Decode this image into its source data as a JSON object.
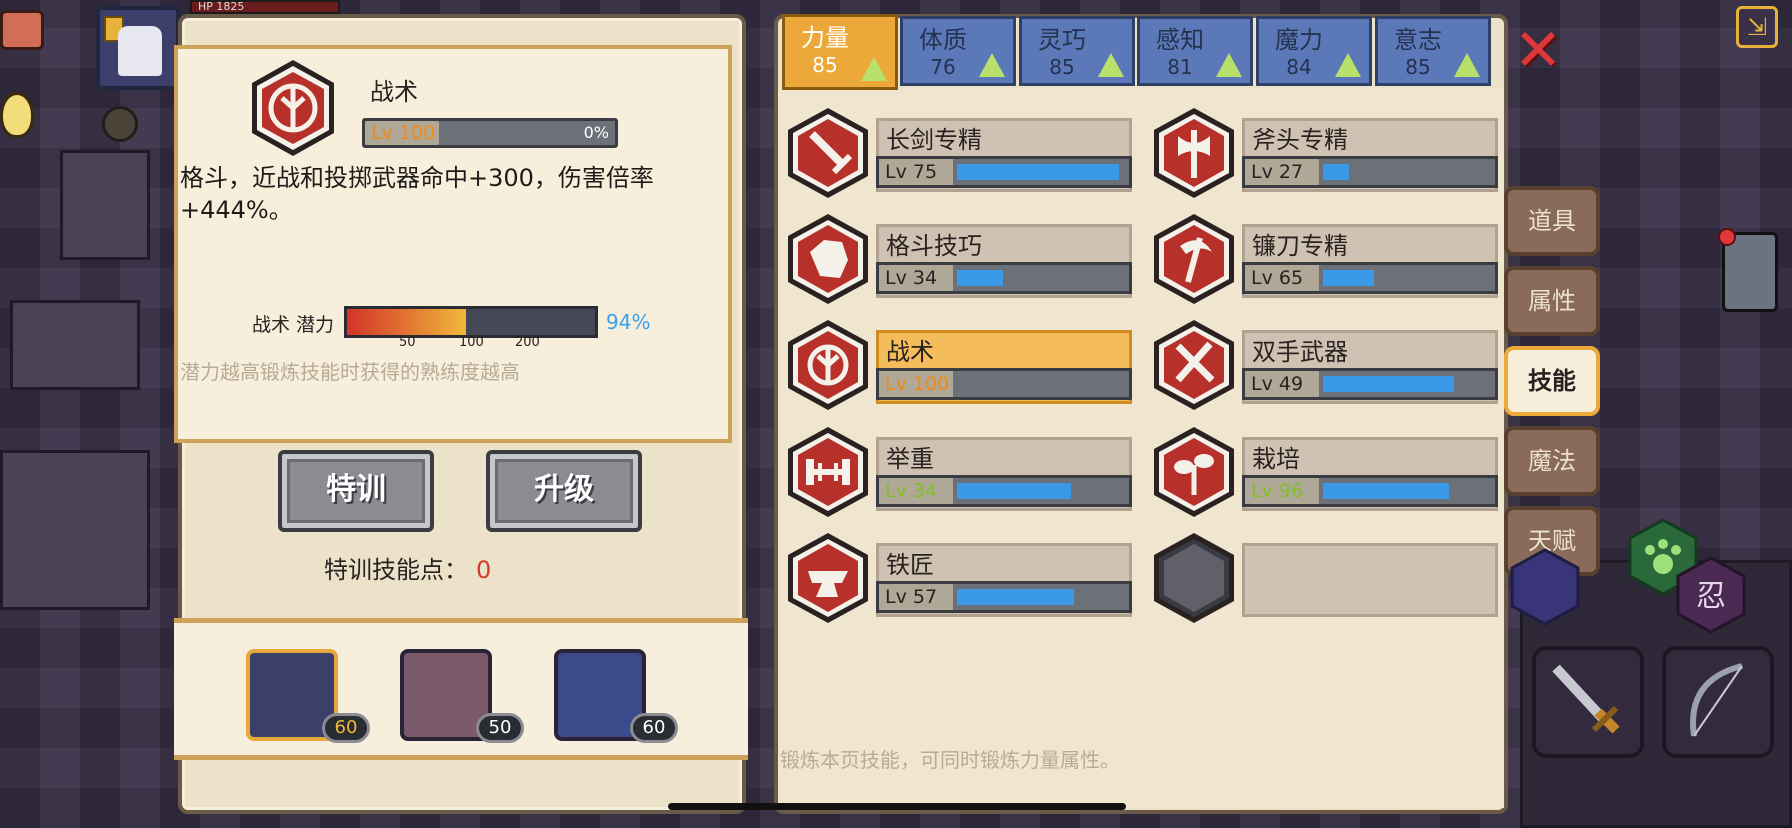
{
  "hud": {
    "hp_label": "HP 1825"
  },
  "detail": {
    "skill_name": "战术",
    "level": "Lv 100",
    "progress_pct": "0%",
    "description": "格斗，近战和投掷武器命中+300，伤害倍率+444%。",
    "potential_label": "战术 潜力",
    "potential_ticks": [
      "50",
      "100",
      "200"
    ],
    "potential_pct": "94%",
    "potential_fill": 0.48,
    "potential_hint": "潜力越高锻炼技能时获得的熟练度越高",
    "train_button": "特训",
    "upgrade_button": "升级",
    "train_points_label": "特训技能点：",
    "train_points_value": "0"
  },
  "characters": [
    {
      "level": "60",
      "selected": true,
      "color": "#3c3f6a"
    },
    {
      "level": "50",
      "selected": false,
      "color": "#7a5a6a"
    },
    {
      "level": "60",
      "selected": false,
      "color": "#3a4a8a"
    }
  ],
  "attribute_tabs": [
    {
      "name": "力量",
      "value": "85",
      "active": true
    },
    {
      "name": "体质",
      "value": "76",
      "active": false
    },
    {
      "name": "灵巧",
      "value": "85",
      "active": false
    },
    {
      "name": "感知",
      "value": "81",
      "active": false
    },
    {
      "name": "魔力",
      "value": "84",
      "active": false
    },
    {
      "name": "意志",
      "value": "85",
      "active": false
    }
  ],
  "skills": [
    {
      "name": "长剑专精",
      "level": "Lv 75",
      "fill": 0.95,
      "icon": "sword-icon",
      "tag_color": "normal"
    },
    {
      "name": "斧头专精",
      "level": "Lv 27",
      "fill": 0.15,
      "icon": "axe-icon",
      "tag_color": "normal"
    },
    {
      "name": "格斗技巧",
      "level": "Lv 34",
      "fill": 0.27,
      "icon": "fist-icon",
      "tag_color": "normal"
    },
    {
      "name": "镰刀专精",
      "level": "Lv 65",
      "fill": 0.3,
      "icon": "scythe-icon",
      "tag_color": "normal"
    },
    {
      "name": "战术",
      "level": "Lv 100",
      "fill": 0,
      "icon": "tactics-icon",
      "tag_color": "orange",
      "active": true
    },
    {
      "name": "双手武器",
      "level": "Lv 49",
      "fill": 0.77,
      "icon": "two-handed-icon",
      "tag_color": "normal"
    },
    {
      "name": "举重",
      "level": "Lv 34",
      "fill": 0.67,
      "icon": "barbell-icon",
      "tag_color": "green"
    },
    {
      "name": "栽培",
      "level": "Lv 96",
      "fill": 0.74,
      "icon": "plant-icon",
      "tag_color": "green"
    },
    {
      "name": "铁匠",
      "level": "Lv 57",
      "fill": 0.69,
      "icon": "anvil-icon",
      "tag_color": "normal"
    },
    {
      "name": "",
      "level": "",
      "fill": 0,
      "icon": "empty-slot-icon",
      "empty": true
    }
  ],
  "side_tabs": [
    {
      "label": "道具",
      "active": false
    },
    {
      "label": "属性",
      "active": false
    },
    {
      "label": "技能",
      "active": true
    },
    {
      "label": "魔法",
      "active": false
    },
    {
      "label": "天赋",
      "active": false
    }
  ],
  "footer_hint": "锻炼本页技能，可同时锻炼力量属性。",
  "close_symbol": "✕",
  "colors": {
    "accent_orange": "#eda83a",
    "tab_blue": "#5b79b8",
    "progress_blue": "#3a9ae8",
    "close_red": "#e0383a",
    "hex_red": "#b8302a"
  }
}
